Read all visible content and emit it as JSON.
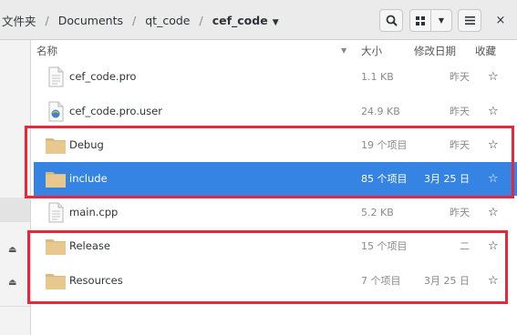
{
  "breadcrumb": {
    "items": [
      "文件夹",
      "Documents",
      "qt_code",
      "cef_code"
    ],
    "separator": "/"
  },
  "toolbar": {
    "search_icon": "search-icon",
    "view_grid_icon": "grid-view-icon",
    "view_options_icon": "chevron-down-icon",
    "menu_icon": "hamburger-menu-icon",
    "close_label": "×"
  },
  "columns": {
    "name": "名称",
    "size": "大小",
    "modified": "修改日期",
    "starred": "收藏"
  },
  "files": [
    {
      "name": "cef_code.pro",
      "type": "text-file",
      "size": "1.1 KB",
      "modified": "昨天",
      "starred": "☆"
    },
    {
      "name": "cef_code.pro.user",
      "type": "xml-file",
      "size": "24.9 KB",
      "modified": "昨天",
      "starred": "☆"
    },
    {
      "name": "Debug",
      "type": "folder",
      "size": "19 个项目",
      "modified": "昨天",
      "starred": "☆"
    },
    {
      "name": "include",
      "type": "folder",
      "size": "85 个项目",
      "modified": "3月 25 日",
      "starred": "☆",
      "selected": true
    },
    {
      "name": "main.cpp",
      "type": "text-file",
      "size": "5.2 KB",
      "modified": "昨天",
      "starred": "☆"
    },
    {
      "name": "Release",
      "type": "folder",
      "size": "15 个项目",
      "modified": "二",
      "starred": "☆"
    },
    {
      "name": "Resources",
      "type": "folder",
      "size": "7 个项目",
      "modified": "3月 25 日",
      "starred": "☆"
    }
  ],
  "sidebar": {
    "eject_icon": "eject-icon"
  },
  "colors": {
    "selection": "#3584e4",
    "annotation": "#e8283a",
    "folder": "#e7c98f"
  }
}
